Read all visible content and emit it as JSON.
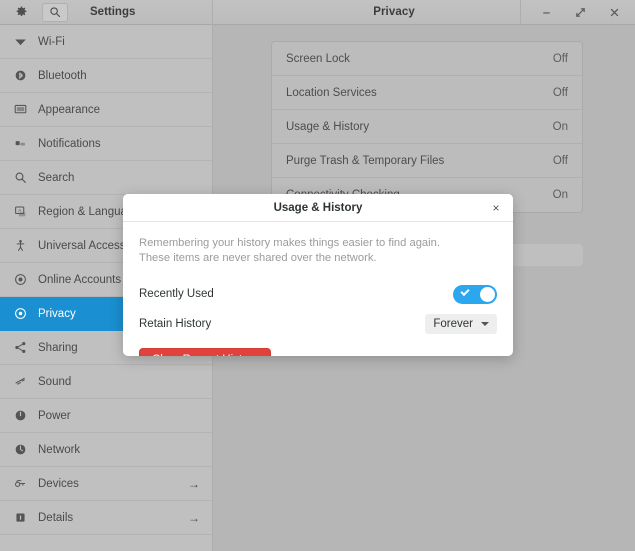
{
  "titlebar": {
    "gear_icon": "gear-icon",
    "search_icon": "search-icon",
    "sidebar_title": "Settings",
    "window_title": "Privacy",
    "minimize_label": "–",
    "maximize_label": "⤡",
    "close_label": "×"
  },
  "sidebar": {
    "items": [
      {
        "label": "Wi-Fi",
        "icon": "wifi-icon",
        "selected": false,
        "arrow": ""
      },
      {
        "label": "Bluetooth",
        "icon": "bluetooth-icon",
        "selected": false,
        "arrow": ""
      },
      {
        "label": "Appearance",
        "icon": "appearance-icon",
        "selected": false,
        "arrow": ""
      },
      {
        "label": "Notifications",
        "icon": "notifications-icon",
        "selected": false,
        "arrow": ""
      },
      {
        "label": "Search",
        "icon": "search-icon",
        "selected": false,
        "arrow": ""
      },
      {
        "label": "Region & Language",
        "icon": "region-language-icon",
        "selected": false,
        "arrow": ""
      },
      {
        "label": "Universal Access",
        "icon": "accessibility-icon",
        "selected": false,
        "arrow": ""
      },
      {
        "label": "Online Accounts",
        "icon": "online-accounts-icon",
        "selected": false,
        "arrow": ""
      },
      {
        "label": "Privacy",
        "icon": "privacy-eye-icon",
        "selected": true,
        "arrow": ""
      },
      {
        "label": "Sharing",
        "icon": "sharing-icon",
        "selected": false,
        "arrow": ""
      },
      {
        "label": "Sound",
        "icon": "sound-icon",
        "selected": false,
        "arrow": ""
      },
      {
        "label": "Power",
        "icon": "power-icon",
        "selected": false,
        "arrow": ""
      },
      {
        "label": "Network",
        "icon": "network-icon",
        "selected": false,
        "arrow": ""
      },
      {
        "label": "Devices",
        "icon": "devices-icon",
        "selected": false,
        "arrow": "→"
      },
      {
        "label": "Details",
        "icon": "details-icon",
        "selected": false,
        "arrow": "→"
      }
    ]
  },
  "main": {
    "rows": [
      {
        "label": "Screen Lock",
        "value": "Off"
      },
      {
        "label": "Location Services",
        "value": "Off"
      },
      {
        "label": "Usage & History",
        "value": "On"
      },
      {
        "label": "Purge Trash & Temporary Files",
        "value": "Off"
      },
      {
        "label": "Connectivity Checking",
        "value": "On"
      }
    ]
  },
  "dialog": {
    "title": "Usage & History",
    "close_label": "×",
    "description_line1": "Remembering your history makes things easier to find again.",
    "description_line2": "These items are never shared over the network.",
    "recently_used_label": "Recently Used",
    "recently_used_state": "on",
    "retain_history_label": "Retain History",
    "retain_history_value": "Forever",
    "retain_history_options": [
      "Forever"
    ],
    "clear_button_label": "Clear Recent History"
  },
  "colors": {
    "selection_blue": "#1a8fd1",
    "switch_blue": "#2aa7ef",
    "destructive_red": "#e0433c",
    "window_bg": "#b6b6b6",
    "sidebar_bg": "#c0c0c0"
  }
}
